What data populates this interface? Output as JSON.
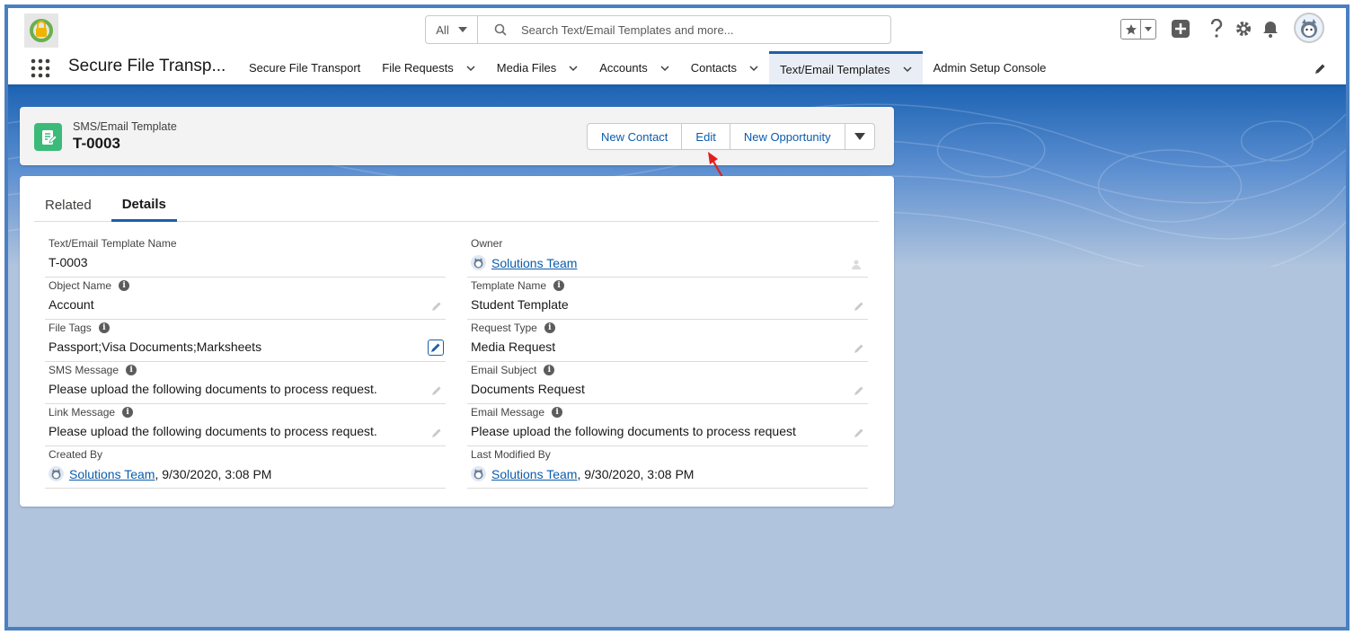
{
  "header": {
    "search_scope": "All",
    "search_placeholder": "Search Text/Email Templates and more..."
  },
  "app": {
    "name": "Secure File Transp..."
  },
  "nav": [
    {
      "label": "Secure File Transport",
      "has_menu": false
    },
    {
      "label": "File Requests",
      "has_menu": true
    },
    {
      "label": "Media Files",
      "has_menu": true
    },
    {
      "label": "Accounts",
      "has_menu": true
    },
    {
      "label": "Contacts",
      "has_menu": true
    },
    {
      "label": "Text/Email Templates",
      "has_menu": true,
      "active": true
    },
    {
      "label": "Admin Setup Console",
      "has_menu": false
    }
  ],
  "record": {
    "object_type": "SMS/Email Template",
    "title": "T-0003",
    "actions": [
      "New Contact",
      "Edit",
      "New Opportunity"
    ]
  },
  "tabs": [
    "Related",
    "Details"
  ],
  "left_fields": [
    {
      "label": "Text/Email Template Name",
      "value": "T-0003"
    },
    {
      "label": "Object Name",
      "value": "Account"
    },
    {
      "label": "File Tags",
      "value": "Passport;Visa Documents;Marksheets"
    },
    {
      "label": "SMS Message",
      "value": "Please upload the following documents to process request."
    },
    {
      "label": "Link Message",
      "value": "Please upload the following documents to process request."
    },
    {
      "label": "Created By",
      "user": "Solutions Team",
      "value": ", 9/30/2020, 3:08 PM"
    }
  ],
  "right_fields": [
    {
      "label": "Owner",
      "user": "Solutions Team"
    },
    {
      "label": "Template Name",
      "value": "Student Template"
    },
    {
      "label": "Request Type",
      "value": "Media Request"
    },
    {
      "label": "Email Subject",
      "value": "Documents Request"
    },
    {
      "label": "Email Message",
      "value": "Please upload the following documents to process request"
    },
    {
      "label": "Last Modified By",
      "user": "Solutions Team",
      "value": ", 9/30/2020, 3:08 PM"
    }
  ],
  "colors": {
    "brand_blue": "#1b5fa8",
    "link_blue": "#0b5cab",
    "record_icon_green": "#3cba7a",
    "annotation_red": "#e02020"
  }
}
